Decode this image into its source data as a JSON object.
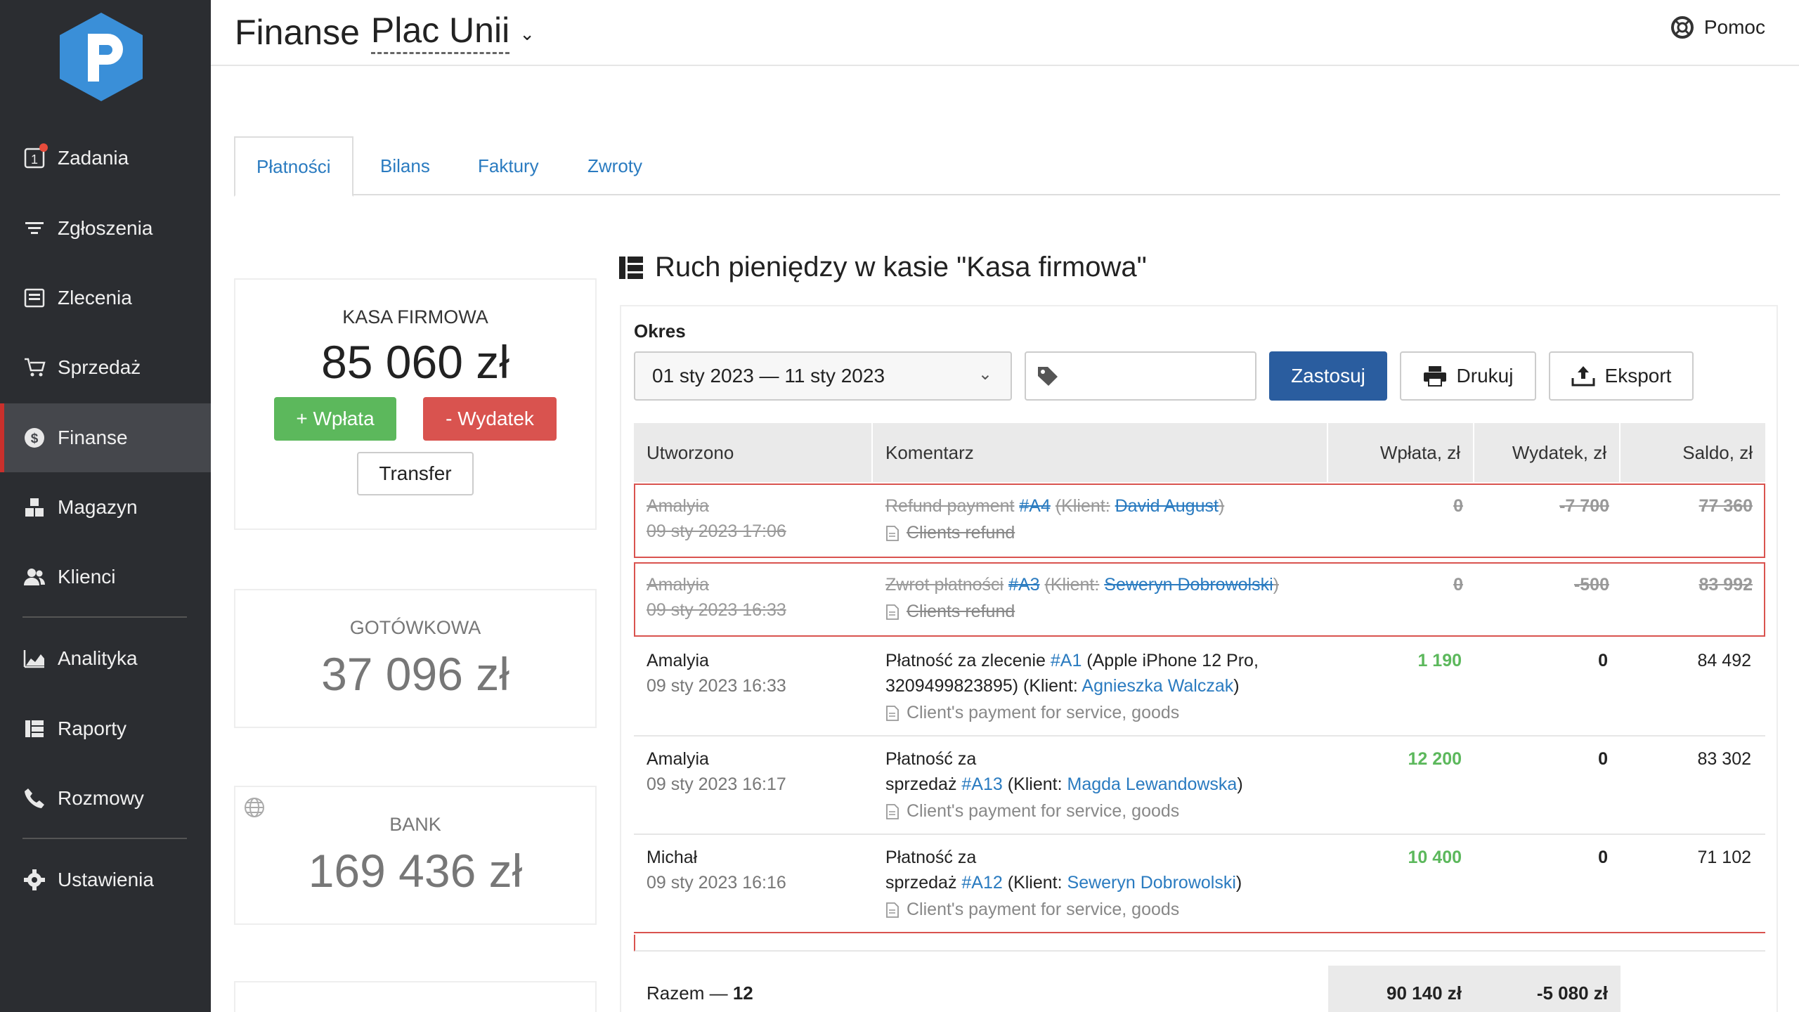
{
  "sidebar": {
    "items": [
      {
        "label": "Zadania",
        "icon": "tasks-icon",
        "badge": "1"
      },
      {
        "label": "Zgłoszenia",
        "icon": "filter-icon"
      },
      {
        "label": "Zlecenia",
        "icon": "orders-icon"
      },
      {
        "label": "Sprzedaż",
        "icon": "cart-icon"
      },
      {
        "label": "Finanse",
        "icon": "dollar-icon",
        "active": true
      },
      {
        "label": "Magazyn",
        "icon": "boxes-icon"
      },
      {
        "label": "Klienci",
        "icon": "users-icon"
      },
      {
        "label": "Analityka",
        "icon": "chart-area-icon"
      },
      {
        "label": "Raporty",
        "icon": "table-icon"
      },
      {
        "label": "Rozmowy",
        "icon": "phone-icon"
      },
      {
        "label": "Ustawienia",
        "icon": "gear-icon"
      }
    ]
  },
  "header": {
    "title_prefix": "Finanse",
    "title_selector": "Plac Unii",
    "help": "Pomoc"
  },
  "tabs": [
    "Płatności",
    "Bilans",
    "Faktury",
    "Zwroty"
  ],
  "cards": {
    "main": {
      "label": "KASA FIRMOWA",
      "amount": "85 060 zł",
      "deposit": "+ Wpłata",
      "expense": "- Wydatek",
      "transfer": "Transfer"
    },
    "cash": {
      "label": "GOTÓWKOWA",
      "amount": "37 096 zł"
    },
    "bank": {
      "label": "BANK",
      "amount": "169 436 zł"
    }
  },
  "section": {
    "title": "Ruch pieniędzy w kasie \"Kasa firmowa\""
  },
  "filter": {
    "period_label": "Okres",
    "date_range": "01 sty 2023 — 11 sty 2023",
    "apply": "Zastosuj",
    "print": "Drukuj",
    "export": "Eksport"
  },
  "table": {
    "headers": [
      "Utworzono",
      "Komentarz",
      "Wpłata, zł",
      "Wydatek, zł",
      "Saldo, zł"
    ],
    "rows": [
      {
        "user": "Amalyia",
        "date": "09 sty 2023 17:06",
        "c1": "Refund payment",
        "ref": "#A4",
        "c2": "(Klient:",
        "client": "David August",
        "c3": ")",
        "c1b": "",
        "note": "Clients refund",
        "in": "0",
        "out": "-7 700",
        "bal": "77 360"
      },
      {
        "user": "Amalyia",
        "date": "09 sty 2023 16:33",
        "c1": "Zwrot płatności",
        "ref": "#A3",
        "c2": "(Klient:",
        "client": "Seweryn Dobrowolski",
        "c3": ")",
        "c1b": "",
        "note": "Clients refund",
        "in": "0",
        "out": "-500",
        "bal": "83 992"
      },
      {
        "user": "Amalyia",
        "date": "09 sty 2023 16:33",
        "c1": "Płatność za zlecenie",
        "ref": "#A1",
        "c2": "(Apple iPhone 12 Pro,",
        "c1b": "3209499823895) (Klient:",
        "client": "Agnieszka Walczak",
        "c3": ")",
        "note": "Client's payment for service, goods",
        "in": "1 190",
        "out": "0",
        "bal": "84 492"
      },
      {
        "user": "Amalyia",
        "date": "09 sty 2023 16:17",
        "c1": "Płatność za",
        "c1b": "sprzedaż",
        "ref": "#A13",
        "c2": "(Klient:",
        "client": "Magda Lewandowska",
        "c3": ")",
        "note": "Client's payment for service, goods",
        "in": "12 200",
        "out": "0",
        "bal": "83 302"
      },
      {
        "user": "Michał",
        "date": "09 sty 2023 16:16",
        "c1": "Płatność za",
        "c1b": "sprzedaż",
        "ref": "#A12",
        "c2": "(Klient:",
        "client": "Seweryn Dobrowolski",
        "c3": ")",
        "note": "Client's payment for service, goods",
        "in": "10 400",
        "out": "0",
        "bal": "71 102"
      }
    ],
    "total_label": "Razem —",
    "total_count": "12",
    "total_in": "90 140 zł",
    "total_out": "-5 080 zł"
  },
  "colors": {
    "sidebar": "#2b2d31",
    "accent": "#2a7bc0",
    "primary": "#2a5d9f",
    "success": "#5cb85c",
    "danger": "#d9534f"
  }
}
